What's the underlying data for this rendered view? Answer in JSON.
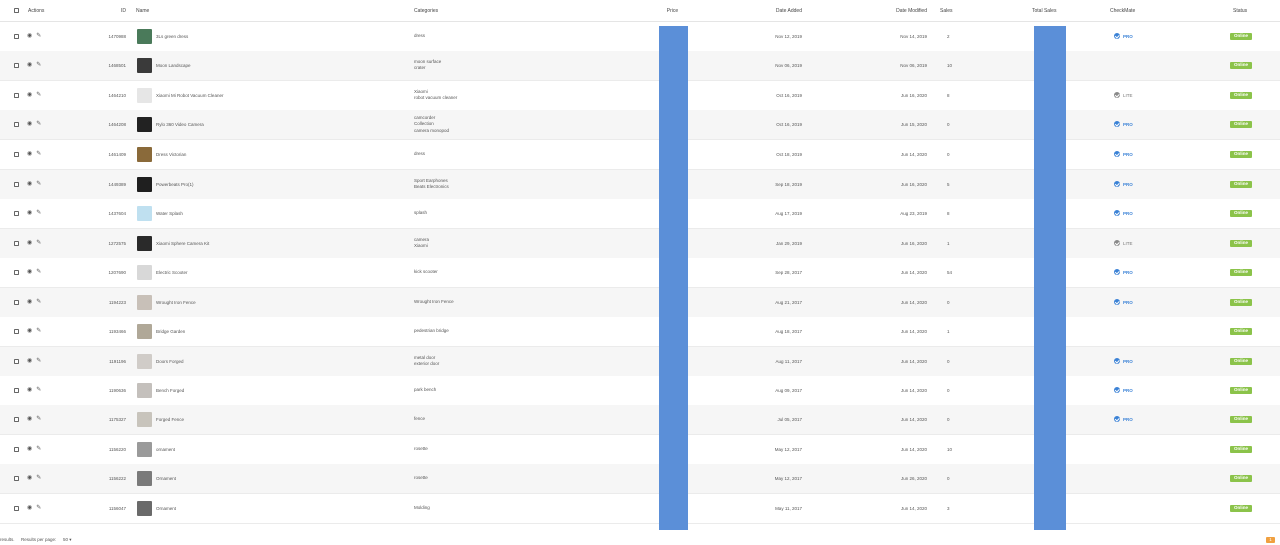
{
  "header": {
    "actions": "Actions",
    "id": "ID",
    "name": "Name",
    "categories": "Categories",
    "price": "Price",
    "date_added": "Date Added",
    "date_modified": "Date Modified",
    "sales": "Sales",
    "total_sales": "Total Sales",
    "checkmate": "CheckMate",
    "status": "Status"
  },
  "rows": [
    {
      "id": "1470988",
      "name": "3Ls green dress",
      "categories": [
        "dress"
      ],
      "date_added": "Nov 12, 2019",
      "date_modified": "Nov 14, 2019",
      "sales": "2",
      "checkmate": "PRO",
      "status": "Online",
      "thumb_color": "#4a7a5a"
    },
    {
      "id": "1468501",
      "name": "Moon Landscape",
      "categories": [
        "moon surface",
        "crater"
      ],
      "date_added": "Nov 06, 2019",
      "date_modified": "Nov 06, 2019",
      "sales": "10",
      "checkmate": "",
      "status": "Online",
      "thumb_color": "#3a3a3a"
    },
    {
      "id": "1464210",
      "name": "Xiaomi Mi Robot Vacuum Cleaner",
      "categories": [
        "Xiaomi",
        "robot vacuum cleaner"
      ],
      "date_added": "Oct 16, 2019",
      "date_modified": "Jun 16, 2020",
      "sales": "8",
      "checkmate": "LITE",
      "status": "Online",
      "thumb_color": "#e6e6e6"
    },
    {
      "id": "1464208",
      "name": "Rylo 360 Video Camera",
      "categories": [
        "camcorder",
        "Collection",
        "camera monopod"
      ],
      "date_added": "Oct 16, 2019",
      "date_modified": "Jun 15, 2020",
      "sales": "0",
      "checkmate": "PRO",
      "status": "Online",
      "thumb_color": "#222222"
    },
    {
      "id": "1461409",
      "name": "Dress Victorian",
      "categories": [
        "dress"
      ],
      "date_added": "Oct 18, 2019",
      "date_modified": "Jun 14, 2020",
      "sales": "0",
      "checkmate": "PRO",
      "status": "Online",
      "thumb_color": "#8a6a3a"
    },
    {
      "id": "1449389",
      "name": "Powerbeats Pro(1)",
      "categories": [
        "Sport Earphones",
        "Beats Electronics"
      ],
      "date_added": "Sep 18, 2019",
      "date_modified": "Jun 16, 2020",
      "sales": "5",
      "checkmate": "PRO",
      "status": "Online",
      "thumb_color": "#1f1f1f"
    },
    {
      "id": "1437604",
      "name": "Water Splash",
      "categories": [
        "splash"
      ],
      "date_added": "Aug 17, 2019",
      "date_modified": "Aug 23, 2019",
      "sales": "8",
      "checkmate": "PRO",
      "status": "Online",
      "thumb_color": "#bfe0f0"
    },
    {
      "id": "1272575",
      "name": "Xiaomi Sphere Camera Kit",
      "categories": [
        "camera",
        "Xiaomi"
      ],
      "date_added": "Jan 29, 2019",
      "date_modified": "Jun 16, 2020",
      "sales": "1",
      "checkmate": "LITE",
      "status": "Online",
      "thumb_color": "#2a2a2a"
    },
    {
      "id": "1207690",
      "name": "Electric Scooter",
      "categories": [
        "kick scooter"
      ],
      "date_added": "Sep 28, 2017",
      "date_modified": "Jun 14, 2020",
      "sales": "54",
      "checkmate": "PRO",
      "status": "Online",
      "thumb_color": "#d8d8d8"
    },
    {
      "id": "1194223",
      "name": "Wrought Iron Fence",
      "categories": [
        "Wrought Iron Fence"
      ],
      "date_added": "Aug 21, 2017",
      "date_modified": "Jun 14, 2020",
      "sales": "0",
      "checkmate": "PRO",
      "status": "Online",
      "thumb_color": "#c8c0b8"
    },
    {
      "id": "1193466",
      "name": "Bridge Garden",
      "categories": [
        "pedestrian bridge"
      ],
      "date_added": "Aug 18, 2017",
      "date_modified": "Jun 14, 2020",
      "sales": "1",
      "checkmate": "",
      "status": "Online",
      "thumb_color": "#b0a898"
    },
    {
      "id": "1191196",
      "name": "Doors Forged",
      "categories": [
        "metal door",
        "exterior door"
      ],
      "date_added": "Aug 11, 2017",
      "date_modified": "Jun 14, 2020",
      "sales": "0",
      "checkmate": "PRO",
      "status": "Online",
      "thumb_color": "#d0ccc8"
    },
    {
      "id": "1190636",
      "name": "Bench Forged",
      "categories": [
        "park bench"
      ],
      "date_added": "Aug 09, 2017",
      "date_modified": "Jun 14, 2020",
      "sales": "0",
      "checkmate": "PRO",
      "status": "Online",
      "thumb_color": "#c4c0bc"
    },
    {
      "id": "1175327",
      "name": "Forged Fence",
      "categories": [
        "fence"
      ],
      "date_added": "Jul 05, 2017",
      "date_modified": "Jun 14, 2020",
      "sales": "0",
      "checkmate": "PRO",
      "status": "Online",
      "thumb_color": "#c8c4bc"
    },
    {
      "id": "1156220",
      "name": "ornament",
      "categories": [
        "rosette"
      ],
      "date_added": "May 12, 2017",
      "date_modified": "Jun 14, 2020",
      "sales": "10",
      "checkmate": "",
      "status": "Online",
      "thumb_color": "#9a9a9a"
    },
    {
      "id": "1156222",
      "name": "Ornament",
      "categories": [
        "rosette"
      ],
      "date_added": "May 12, 2017",
      "date_modified": "Jun 26, 2020",
      "sales": "0",
      "checkmate": "",
      "status": "Online",
      "thumb_color": "#7a7a7a"
    },
    {
      "id": "1156047",
      "name": "Ornament",
      "categories": [
        "Molding"
      ],
      "date_added": "May 11, 2017",
      "date_modified": "Jun 14, 2020",
      "sales": "3",
      "checkmate": "",
      "status": "Online",
      "thumb_color": "#6a6a6a"
    }
  ],
  "footer": {
    "results_label": "results.",
    "per_page_label": "Results per page:",
    "per_page_value": "50",
    "page_number": "1"
  },
  "colors": {
    "redaction": "#5b8fd8",
    "pro": "#3b82d6",
    "lite": "#8a8a8a",
    "online": "#8bc34a",
    "page_btn": "#f0a040"
  }
}
